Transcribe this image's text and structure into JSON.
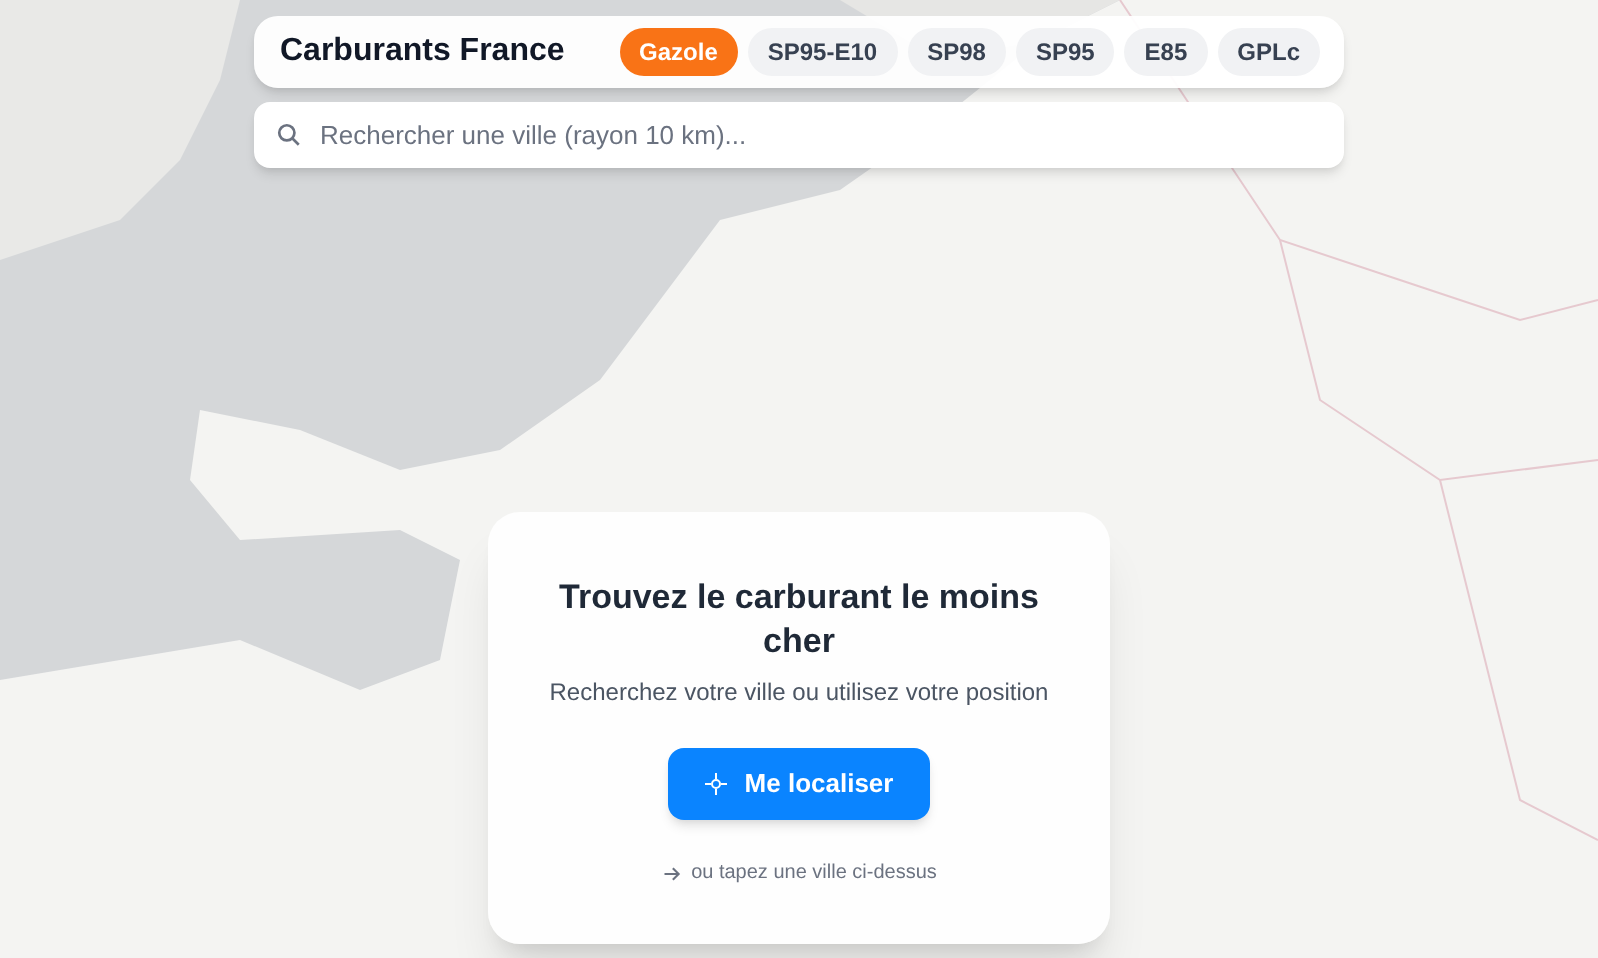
{
  "header": {
    "title": "Carburants France"
  },
  "fuel_tabs": [
    {
      "label": "Gazole",
      "selected": true
    },
    {
      "label": "SP95-E10",
      "selected": false
    },
    {
      "label": "SP98",
      "selected": false
    },
    {
      "label": "SP95",
      "selected": false
    },
    {
      "label": "E85",
      "selected": false
    },
    {
      "label": "GPLc",
      "selected": false
    }
  ],
  "search": {
    "placeholder": "Rechercher une ville (rayon 10 km)..."
  },
  "welcome_card": {
    "title": "Trouvez le carburant le moins cher",
    "subtitle": "Recherchez votre ville ou utilisez votre position",
    "button": "Me localiser",
    "hint": "ou tapez une ville ci-dessus"
  }
}
